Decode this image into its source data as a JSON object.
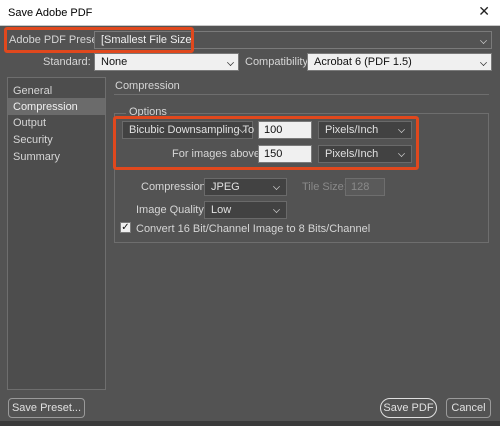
{
  "window": {
    "title": "Save Adobe PDF",
    "close_glyph": "✕"
  },
  "preset": {
    "label": "Adobe PDF Preset:",
    "value": "[Smallest File Size]"
  },
  "standard": {
    "label": "Standard:",
    "value": "None"
  },
  "compatibility": {
    "label": "Compatibility:",
    "value": "Acrobat 6 (PDF 1.5)"
  },
  "sidebar": {
    "items": [
      {
        "label": "General",
        "active": false
      },
      {
        "label": "Compression",
        "active": true
      },
      {
        "label": "Output",
        "active": false
      },
      {
        "label": "Security",
        "active": false
      },
      {
        "label": "Summary",
        "active": false
      }
    ]
  },
  "panel": {
    "title": "Compression"
  },
  "options": {
    "legend": "Options",
    "downsampling": {
      "method": "Bicubic Downsampling To",
      "value": "100",
      "unit": "Pixels/Inch"
    },
    "above": {
      "label": "For images above:",
      "value": "150",
      "unit": "Pixels/Inch"
    },
    "compression": {
      "label": "Compression:",
      "value": "JPEG"
    },
    "tile_size": {
      "label": "Tile Size:",
      "value": "128"
    },
    "image_quality": {
      "label": "Image Quality:",
      "value": "Low"
    },
    "convert": {
      "label": "Convert 16 Bit/Channel Image to 8 Bits/Channel",
      "checked": true,
      "check_glyph": "✓"
    }
  },
  "buttons": {
    "save_preset": "Save Preset...",
    "save_pdf": "Save PDF",
    "cancel": "Cancel"
  },
  "colors": {
    "highlight": "#e0481d",
    "background": "#535353",
    "selected_item": "#6b6b6b"
  }
}
